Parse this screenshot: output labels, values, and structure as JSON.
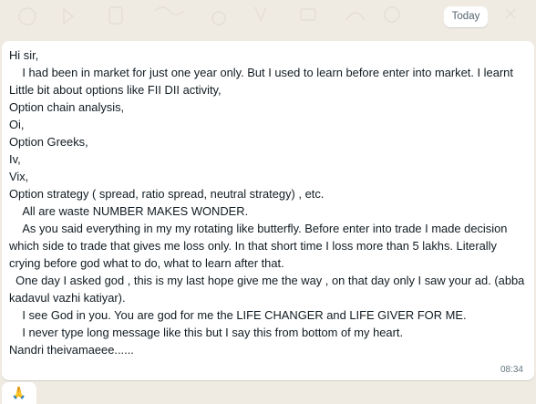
{
  "chat": {
    "date_label": "Today",
    "message": {
      "text": "Hi sir,\n    I had been in market for just one year only. But I used to learn before enter into market. I learnt\nLittle bit about options like FII DII activity,\nOption chain analysis,\nOi,\nOption Greeks,\nIv,\nVix,\nOption strategy ( spread, ratio spread, neutral strategy) , etc.\n    All are waste NUMBER MAKES WONDER.\n    As you said everything in my my rotating like butterfly. Before enter into trade I made decision which side to trade that gives me loss only. In that short time I loss more than 5 lakhs. Literally crying before god what to do, what to learn after that.\n  One day I asked god , this is my last hope give me the way , on that day only I saw your ad. (abba kadavul vazhi katiyar).\n    I see God in you. You are god for me the LIFE CHANGER and LIFE GIVER FOR ME.\n    I never type long message like this but I say this from bottom of my heart.\nNandri theivamaeee......",
      "time": "08:34"
    },
    "next_message": {
      "emoji": "🙏"
    }
  },
  "colors": {
    "wallpaper": "#efeae2",
    "bubble": "#ffffff",
    "text": "#111b21",
    "meta": "#667781"
  }
}
